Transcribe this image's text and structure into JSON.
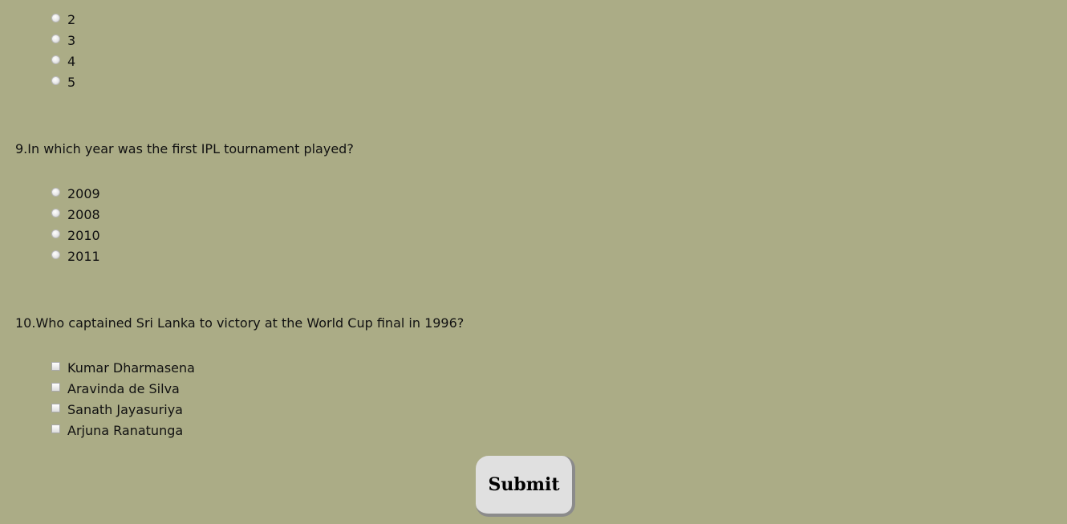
{
  "q8": {
    "options": [
      "2",
      "3",
      "4",
      "5"
    ]
  },
  "q9": {
    "question": "9.In which year was the first IPL tournament played?",
    "options": [
      "2009",
      "2008",
      "2010",
      "2011"
    ]
  },
  "q10": {
    "question": "10.Who captained Sri Lanka to victory at the World Cup final in 1996?",
    "options": [
      "Kumar Dharmasena",
      "Aravinda de Silva",
      "Sanath Jayasuriya",
      "Arjuna Ranatunga"
    ]
  },
  "submit": {
    "label": "Submit"
  }
}
